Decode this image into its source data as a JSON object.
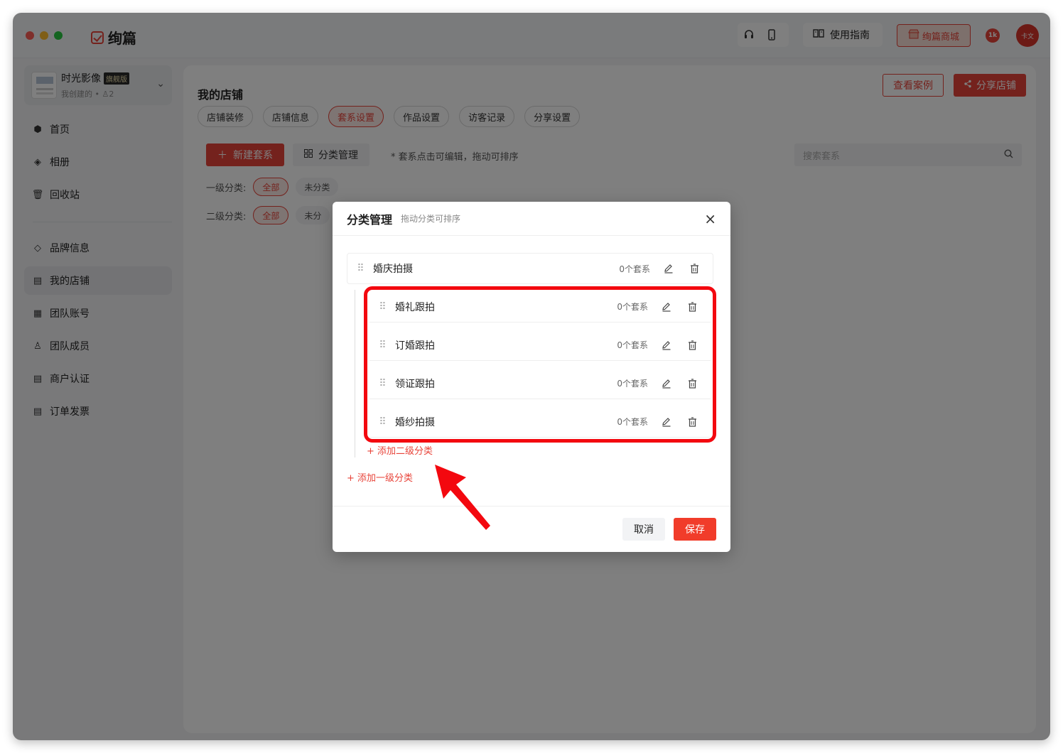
{
  "app": {
    "name": "绚篇",
    "guide_label": "使用指南",
    "mall_label": "绚篇商城",
    "notif_badge": "1k",
    "avatar_text": "卡文"
  },
  "sidebar": {
    "store_name": "时光影像",
    "store_tag": "旗舰版",
    "store_sub": "我创建的 • ♙2",
    "items": [
      {
        "label": "首页"
      },
      {
        "label": "相册"
      },
      {
        "label": "回收站"
      },
      {
        "label": "品牌信息"
      },
      {
        "label": "我的店铺"
      },
      {
        "label": "团队账号"
      },
      {
        "label": "团队成员"
      },
      {
        "label": "商户认证"
      },
      {
        "label": "订单发票"
      }
    ]
  },
  "main": {
    "title": "我的店铺",
    "view_cases": "查看案例",
    "share_store": "分享店铺",
    "tabs": [
      {
        "label": "店铺装修"
      },
      {
        "label": "店铺信息"
      },
      {
        "label": "套系设置"
      },
      {
        "label": "作品设置"
      },
      {
        "label": "访客记录"
      },
      {
        "label": "分享设置"
      }
    ],
    "new_package": "新建套系",
    "category_manage": "分类管理",
    "hint": "* 套系点击可编辑，拖动可排序",
    "search_placeholder": "搜索套系",
    "filter1_label": "一级分类:",
    "filter2_label": "二级分类:",
    "chip_all": "全部",
    "chip_uncat": "未分类",
    "chip_uncat_partial": "未分"
  },
  "modal": {
    "title": "分类管理",
    "subtitle": "拖动分类可排序",
    "close": "×",
    "level1": {
      "name": "婚庆拍摄",
      "count": "0个套系"
    },
    "level2": [
      {
        "name": "婚礼跟拍",
        "count": "0个套系"
      },
      {
        "name": "订婚跟拍",
        "count": "0个套系"
      },
      {
        "name": "领证跟拍",
        "count": "0个套系"
      },
      {
        "name": "婚纱拍摄",
        "count": "0个套系"
      }
    ],
    "add_level2": "+ 添加二级分类",
    "add_level1": "+ 添加一级分类",
    "cancel": "取消",
    "save": "保存"
  },
  "colors": {
    "accent": "#e8443a",
    "annotation": "#f3080f"
  }
}
